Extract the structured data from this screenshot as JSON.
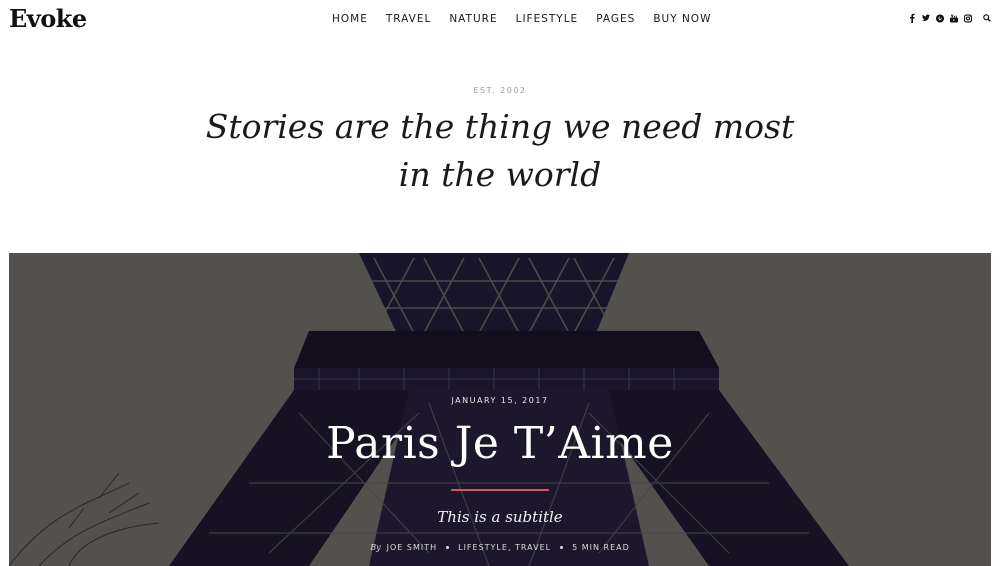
{
  "header": {
    "logo": "Evoke",
    "nav": [
      "HOME",
      "TRAVEL",
      "NATURE",
      "LIFESTYLE",
      "PAGES",
      "BUY NOW"
    ],
    "social_icons": [
      "facebook-icon",
      "twitter-icon",
      "pinterest-icon",
      "youtube-icon",
      "instagram-icon"
    ],
    "search_icon": "search-icon"
  },
  "intro": {
    "est": "EST. 2002",
    "tagline": "Stories are the thing we need most in the world"
  },
  "featured_post": {
    "date": "JANUARY 15, 2017",
    "title": "Paris Je T’Aime",
    "subtitle": "This is a subtitle",
    "by": "By",
    "author": "JOE SMITH",
    "categories": "LIFESTYLE, TRAVEL",
    "read_time": "5 MIN READ",
    "accent_color": "#d9535e"
  }
}
